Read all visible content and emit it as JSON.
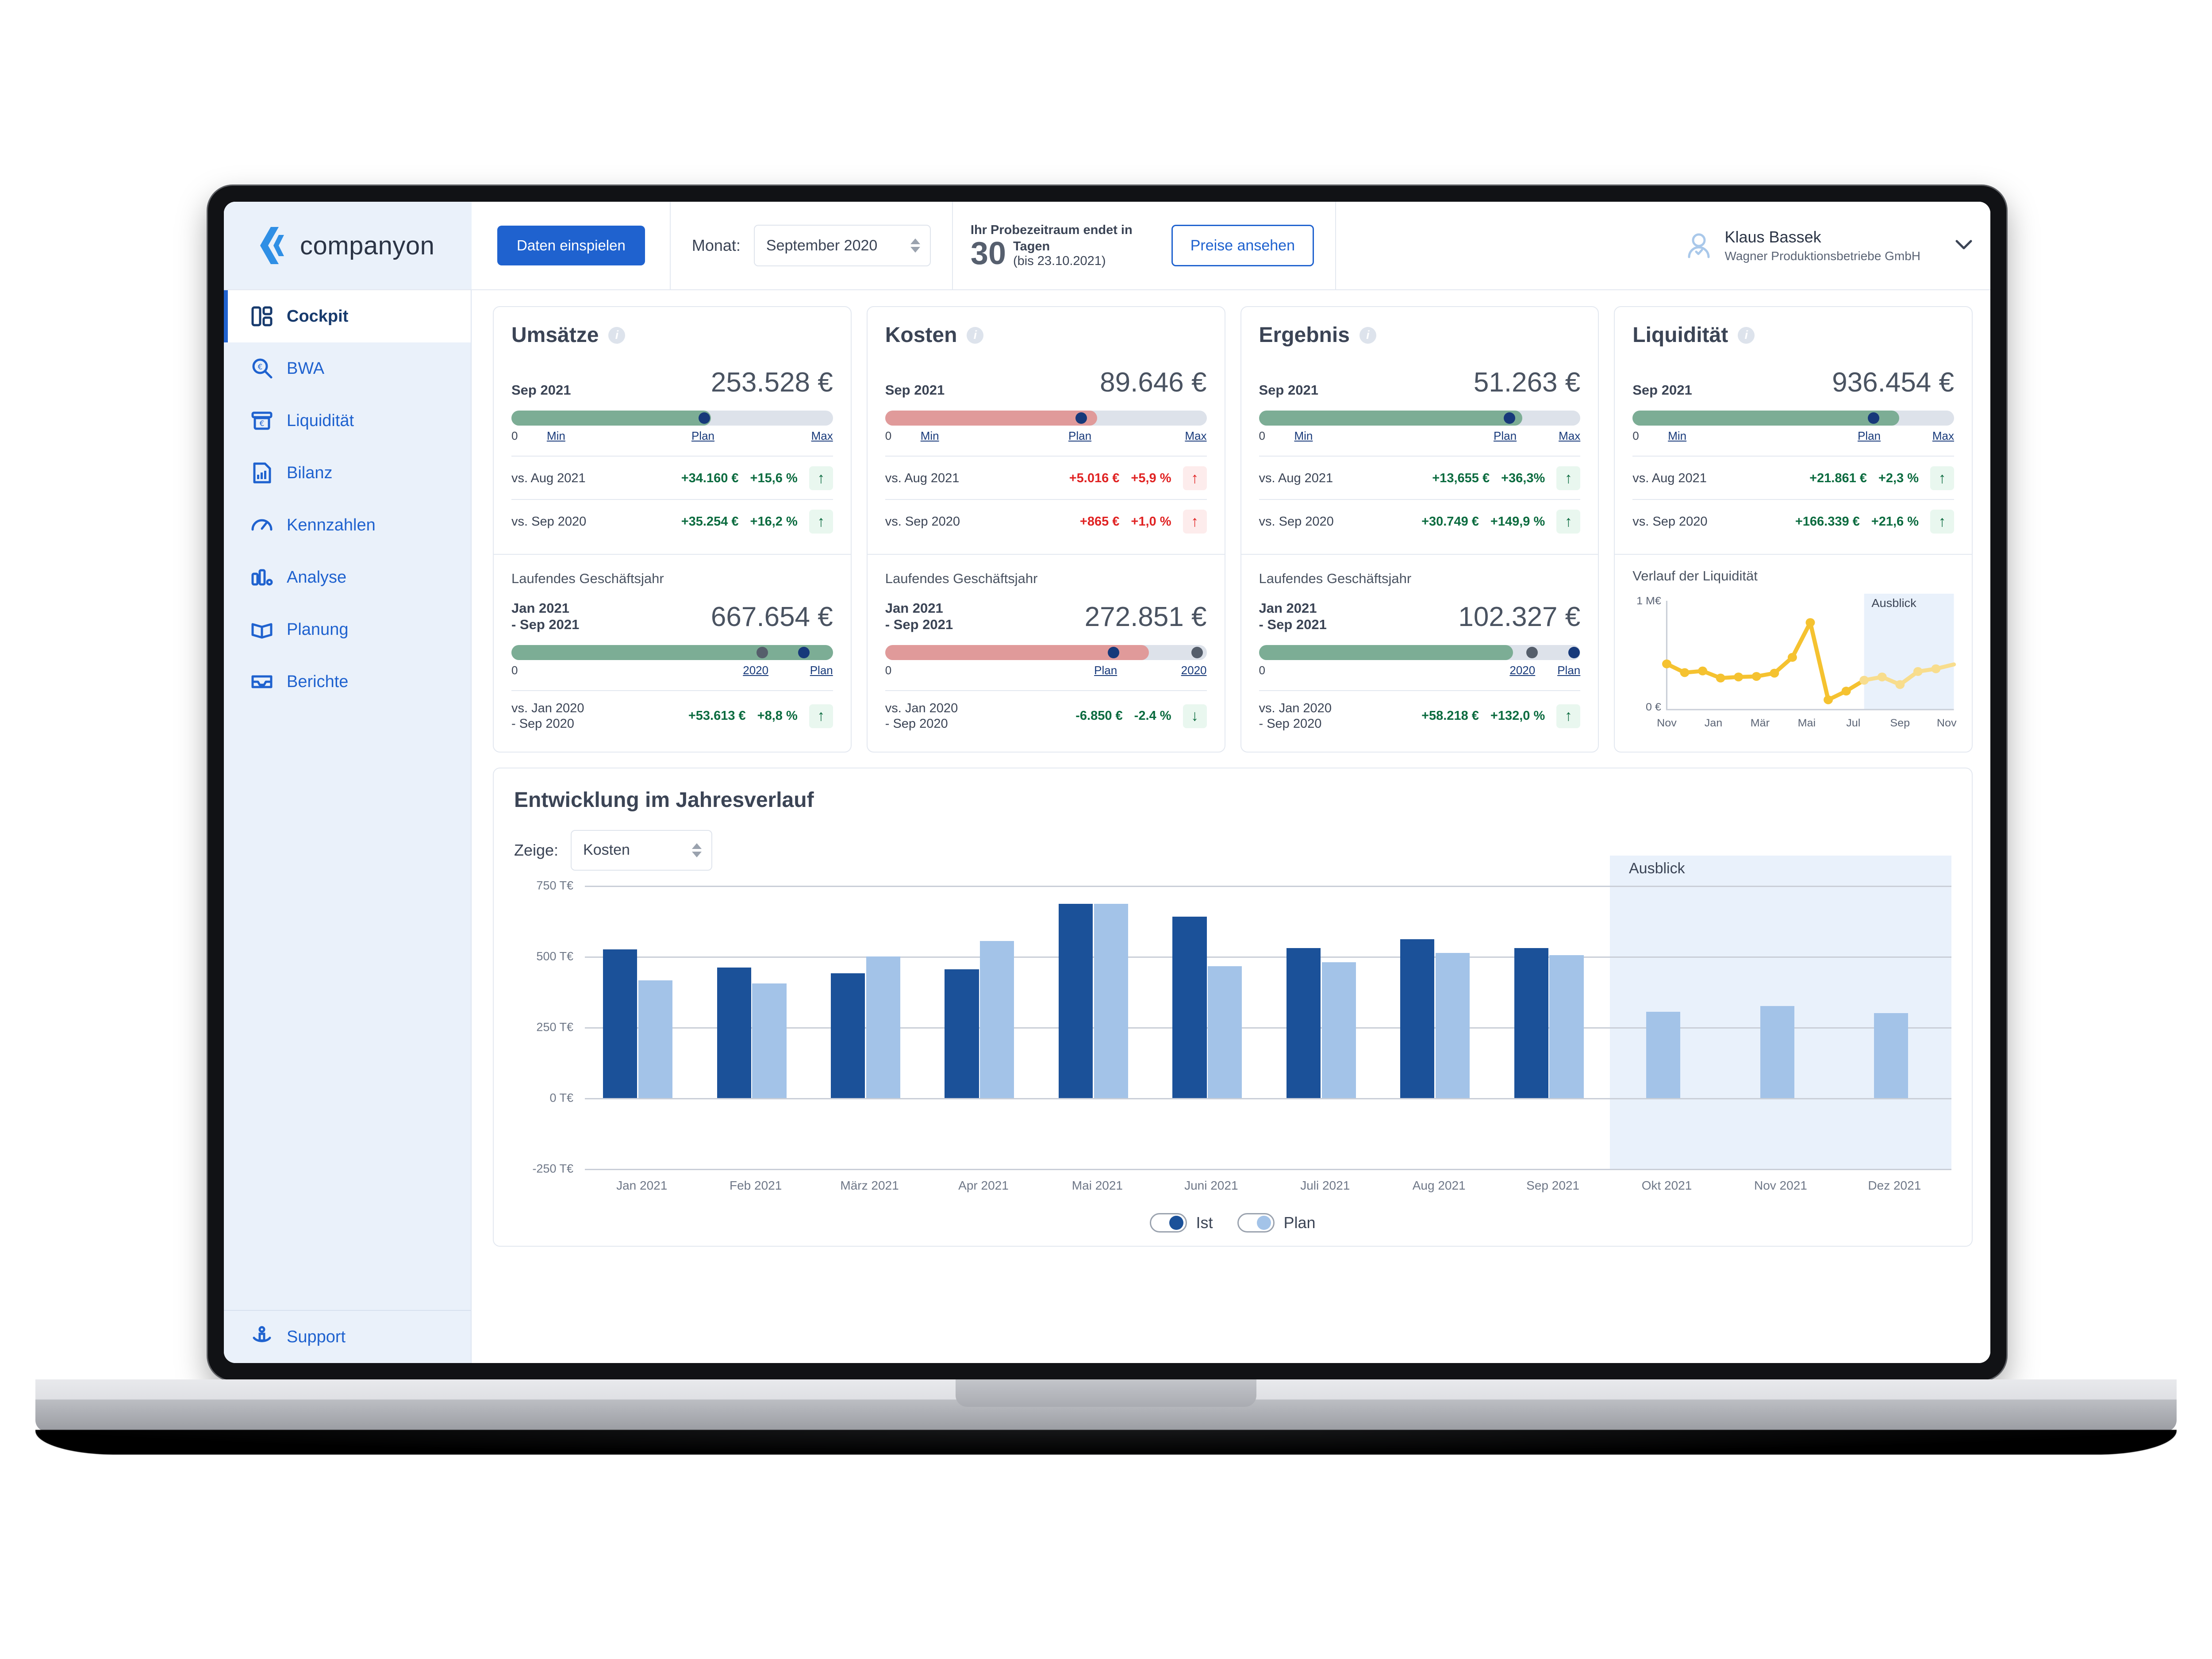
{
  "brand": {
    "name": "companyon"
  },
  "topbar": {
    "import_button": "Daten einspielen",
    "month_label": "Monat:",
    "month_value": "September 2020",
    "trial_prefix": "Ihr Probezeitraum endet in",
    "trial_days": "30",
    "trial_days_unit": "Tagen",
    "trial_until": "(bis 23.10.2021)",
    "pricing_button": "Preise ansehen",
    "user_name": "Klaus Bassek",
    "user_org": "Wagner Produktionsbetriebe GmbH"
  },
  "sidebar": {
    "items": [
      {
        "label": "Cockpit",
        "icon": "dashboard-icon",
        "active": true
      },
      {
        "label": "BWA",
        "icon": "magnifier-euro-icon",
        "active": false
      },
      {
        "label": "Liquidität",
        "icon": "cash-machine-icon",
        "active": false
      },
      {
        "label": "Bilanz",
        "icon": "document-chart-icon",
        "active": false
      },
      {
        "label": "Kennzahlen",
        "icon": "gauge-icon",
        "active": false
      },
      {
        "label": "Analyse",
        "icon": "bar-chart-icon",
        "active": false
      },
      {
        "label": "Planung",
        "icon": "open-book-icon",
        "active": false
      },
      {
        "label": "Berichte",
        "icon": "inbox-tray-icon",
        "active": false
      }
    ],
    "support": {
      "label": "Support",
      "icon": "support-info-icon"
    }
  },
  "kpi_cards": [
    {
      "title": "Umsätze",
      "tone": "green",
      "month": {
        "period": "Sep 2021",
        "amount": "253.528 €",
        "fill_pct": 62,
        "markers": [
          {
            "type": "plan",
            "pos": 60
          }
        ],
        "scale": [
          {
            "text": "0",
            "pos": 0,
            "link": false
          },
          {
            "text": "Min",
            "pos": 12,
            "link": true
          },
          {
            "text": "Plan",
            "pos": 60,
            "link": true
          },
          {
            "text": "Max",
            "pos": 100,
            "link": true
          }
        ],
        "comparisons": [
          {
            "label": "vs. Aug 2021",
            "abs": "+34.160 €",
            "pct": "+15,6 %",
            "dir": "up",
            "sign": "pos"
          },
          {
            "label": "vs. Sep 2020",
            "abs": "+35.254 €",
            "pct": "+16,2 %",
            "dir": "up",
            "sign": "pos"
          }
        ]
      },
      "year": {
        "sub_title": "Laufendes Geschäftsjahr",
        "period": "Jan 2021\n- Sep 2021",
        "amount": "667.654 €",
        "fill_pct": 100,
        "markers": [
          {
            "type": "prev",
            "pos": 78
          },
          {
            "type": "plan",
            "pos": 91
          }
        ],
        "scale": [
          {
            "text": "0",
            "pos": 0,
            "link": false
          },
          {
            "text": "2020",
            "pos": 78,
            "link": true
          },
          {
            "text": "Plan",
            "pos": 92,
            "link": true
          }
        ],
        "comparison": {
          "label": "vs. Jan 2020\n- Sep 2020",
          "abs": "+53.613 €",
          "pct": "+8,8 %",
          "dir": "up",
          "sign": "pos"
        }
      }
    },
    {
      "title": "Kosten",
      "tone": "red",
      "month": {
        "period": "Sep 2021",
        "amount": "89.646 €",
        "fill_pct": 66,
        "markers": [
          {
            "type": "plan",
            "pos": 61
          }
        ],
        "scale": [
          {
            "text": "0",
            "pos": 0,
            "link": false
          },
          {
            "text": "Min",
            "pos": 12,
            "link": true
          },
          {
            "text": "Plan",
            "pos": 61,
            "link": true
          },
          {
            "text": "Max",
            "pos": 100,
            "link": true
          }
        ],
        "comparisons": [
          {
            "label": "vs. Aug 2021",
            "abs": "+5.016 €",
            "pct": "+5,9 %",
            "dir": "up",
            "sign": "neg"
          },
          {
            "label": "vs. Sep 2020",
            "abs": "+865 €",
            "pct": "+1,0 %",
            "dir": "up",
            "sign": "neg"
          }
        ]
      },
      "year": {
        "sub_title": "Laufendes Geschäftsjahr",
        "period": "Jan 2021\n- Sep 2021",
        "amount": "272.851 €",
        "fill_pct": 82,
        "markers": [
          {
            "type": "plan",
            "pos": 71
          },
          {
            "type": "prev",
            "pos": 97
          }
        ],
        "scale": [
          {
            "text": "0",
            "pos": 0,
            "link": false
          },
          {
            "text": "Plan",
            "pos": 71,
            "link": true
          },
          {
            "text": "2020",
            "pos": 96,
            "link": true
          }
        ],
        "comparison": {
          "label": "vs. Jan 2020\n- Sep 2020",
          "abs": "-6.850 €",
          "pct": "-2.4 %",
          "dir": "down",
          "sign": "pos"
        }
      }
    },
    {
      "title": "Ergebnis",
      "tone": "green",
      "month": {
        "period": "Sep 2021",
        "amount": "51.263 €",
        "fill_pct": 82,
        "markers": [
          {
            "type": "plan",
            "pos": 78
          }
        ],
        "scale": [
          {
            "text": "0",
            "pos": 0,
            "link": false
          },
          {
            "text": "Min",
            "pos": 12,
            "link": true
          },
          {
            "text": "Plan",
            "pos": 78,
            "link": true
          },
          {
            "text": "Max",
            "pos": 100,
            "link": true
          }
        ],
        "comparisons": [
          {
            "label": "vs. Aug 2021",
            "abs": "+13,655 €",
            "pct": "+36,3%",
            "dir": "up",
            "sign": "pos"
          },
          {
            "label": "vs. Sep 2020",
            "abs": "+30.749 €",
            "pct": "+149,9 %",
            "dir": "up",
            "sign": "pos"
          }
        ]
      },
      "year": {
        "sub_title": "Laufendes Geschäftsjahr",
        "period": "Jan 2021\n- Sep 2021",
        "amount": "102.327 €",
        "fill_pct": 79,
        "markers": [
          {
            "type": "prev",
            "pos": 85
          },
          {
            "type": "plan",
            "pos": 98
          }
        ],
        "scale": [
          {
            "text": "0",
            "pos": 0,
            "link": false
          },
          {
            "text": "2020",
            "pos": 84,
            "link": true
          },
          {
            "text": "Plan",
            "pos": 98,
            "link": true
          }
        ],
        "comparison": {
          "label": "vs. Jan 2020\n- Sep 2020",
          "abs": "+58.218 €",
          "pct": "+132,0 %",
          "dir": "up",
          "sign": "pos"
        }
      }
    },
    {
      "title": "Liquidität",
      "tone": "green",
      "month": {
        "period": "Sep 2021",
        "amount": "936.454 €",
        "fill_pct": 83,
        "markers": [
          {
            "type": "plan",
            "pos": 75
          }
        ],
        "scale": [
          {
            "text": "0",
            "pos": 0,
            "link": false
          },
          {
            "text": "Min",
            "pos": 12,
            "link": true
          },
          {
            "text": "Plan",
            "pos": 74,
            "link": true
          },
          {
            "text": "Max",
            "pos": 100,
            "link": true
          }
        ],
        "comparisons": [
          {
            "label": "vs. Aug 2021",
            "abs": "+21.861 €",
            "pct": "+2,3 %",
            "dir": "up",
            "sign": "pos"
          },
          {
            "label": "vs. Sep 2020",
            "abs": "+166.339 €",
            "pct": "+21,6 %",
            "dir": "up",
            "sign": "pos"
          }
        ]
      },
      "sparkline": {
        "title": "Verlauf der Liquidität"
      }
    }
  ],
  "main_chart": {
    "title": "Entwicklung im Jahresverlauf",
    "control_label": "Zeige:",
    "control_value": "Kosten",
    "forecast_label": "Ausblick",
    "legend": [
      {
        "label": "Ist",
        "color": "#1b5199"
      },
      {
        "label": "Plan",
        "color": "#a3c3e8"
      }
    ]
  },
  "chart_data": {
    "type": "bar",
    "title": "Entwicklung im Jahresverlauf",
    "subtitle": "Kosten",
    "xlabel": "",
    "ylabel": "T€",
    "ylim": [
      -250,
      750
    ],
    "yticks": [
      750,
      500,
      250,
      0,
      -250
    ],
    "ytick_labels": [
      "750 T€",
      "500 T€",
      "250 T€",
      "0 T€",
      "-250 T€"
    ],
    "grid": true,
    "legend_position": "bottom",
    "categories": [
      "Jan 2021",
      "Feb 2021",
      "März 2021",
      "Apr 2021",
      "Mai 2021",
      "Juni 2021",
      "Juli 2021",
      "Aug 2021",
      "Sep 2021",
      "Okt 2021",
      "Nov 2021",
      "Dez 2021"
    ],
    "series": [
      {
        "name": "Ist",
        "color": "#1b5199",
        "values": [
          525,
          460,
          440,
          455,
          685,
          640,
          530,
          560,
          530,
          null,
          null,
          null
        ]
      },
      {
        "name": "Plan",
        "color": "#a3c3e8",
        "values": [
          415,
          405,
          500,
          555,
          685,
          465,
          480,
          512,
          505,
          305,
          325,
          300
        ]
      }
    ],
    "forecast_from": "Okt 2021",
    "forecast_label": "Ausblick"
  },
  "liquidity_sparkline": {
    "type": "line",
    "title": "Verlauf der Liquidität",
    "ytick_labels": [
      "1 M€",
      "0 €"
    ],
    "ylim": [
      0,
      1000000
    ],
    "xtick_labels": [
      "Nov",
      "Jan",
      "Mär",
      "Mai",
      "Jul",
      "Sep",
      "Nov"
    ],
    "forecast_label": "Ausblick",
    "color": "#f5c230",
    "forecast_color": "#f8dd8d",
    "points": [
      {
        "x": "Nov",
        "y": 420
      },
      {
        "x": "Dez",
        "y": 340
      },
      {
        "x": "Jan",
        "y": 355
      },
      {
        "x": "Feb",
        "y": 290
      },
      {
        "x": "Mär",
        "y": 300
      },
      {
        "x": "Apr",
        "y": 305
      },
      {
        "x": "Mai",
        "y": 335
      },
      {
        "x": "Jun",
        "y": 480
      },
      {
        "x": "Jul",
        "y": 800
      },
      {
        "x": "Aug",
        "y": 90
      },
      {
        "x": "Sep",
        "y": 170
      },
      {
        "x": "Okt",
        "y": 270
      },
      {
        "x": "Nov",
        "y": 300
      },
      {
        "x": "Dez",
        "y": 230
      },
      {
        "x": "Jan",
        "y": 350
      },
      {
        "x": "Feb",
        "y": 375
      },
      {
        "x": "Mär",
        "y": 415
      }
    ]
  }
}
